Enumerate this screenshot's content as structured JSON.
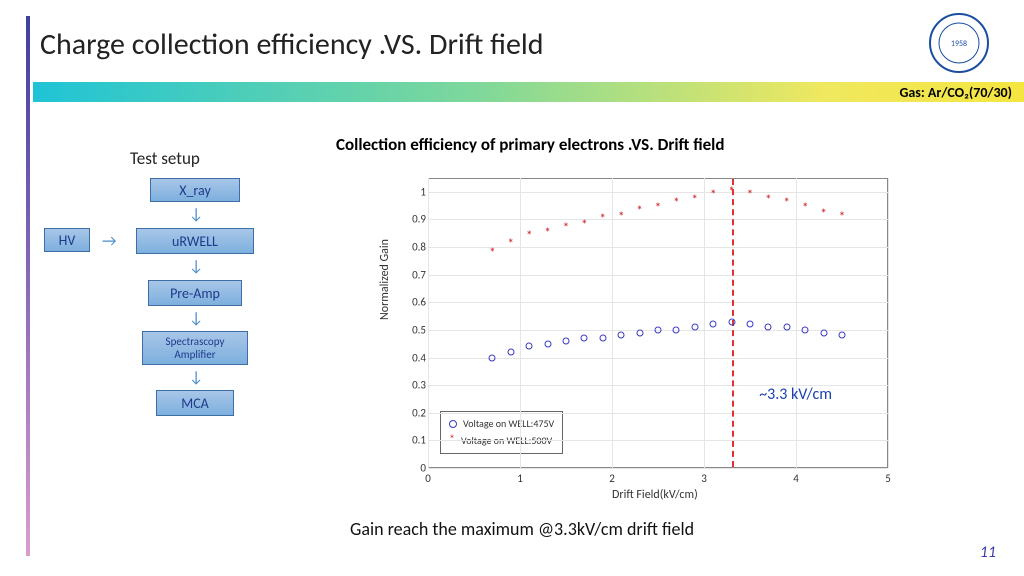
{
  "title": "Charge collection efficiency .VS. Drift field",
  "band_text": "Gas: Ar/CO₂(70/30)",
  "setup_title": "Test setup",
  "flow": {
    "xray": "X_ray",
    "hv": "HV",
    "urwell": "uRWELL",
    "preamp": "Pre-Amp",
    "spec": "Spectrascopy\nAmplifier",
    "mca": "MCA"
  },
  "chart_title": "Collection efficiency of primary electrons .VS. Drift field",
  "annotation": "~3.3 kV/cm",
  "caption": "Gain reach the maximum @3.3kV/cm drift field",
  "page": "11",
  "legend": {
    "s1": "Voltage on WELL:475V",
    "s2": "Voltage on WELL:500V"
  },
  "chart_data": {
    "type": "scatter",
    "title": "Collection efficiency of primary electrons .VS. Drift field",
    "xlabel": "Drift Field(kV/cm)",
    "ylabel": "Normalized Gain",
    "xlim": [
      0,
      5
    ],
    "ylim": [
      0,
      1.05
    ],
    "xticks": [
      0,
      1,
      2,
      3,
      4,
      5
    ],
    "yticks": [
      0,
      0.1,
      0.2,
      0.3,
      0.4,
      0.5,
      0.6,
      0.7,
      0.8,
      0.9,
      1
    ],
    "vline": 3.3,
    "annotation": {
      "text": "~3.3 kV/cm",
      "x": 3.6,
      "y": 0.3
    },
    "legend_position": "lower-left",
    "series": [
      {
        "name": "Voltage on WELL:475V",
        "marker": "circle",
        "color": "#3a3ac0",
        "x": [
          0.7,
          0.9,
          1.1,
          1.3,
          1.5,
          1.7,
          1.9,
          2.1,
          2.3,
          2.5,
          2.7,
          2.9,
          3.1,
          3.3,
          3.5,
          3.7,
          3.9,
          4.1,
          4.3,
          4.5
        ],
        "y": [
          0.4,
          0.42,
          0.44,
          0.45,
          0.46,
          0.47,
          0.47,
          0.48,
          0.49,
          0.5,
          0.5,
          0.51,
          0.52,
          0.53,
          0.52,
          0.51,
          0.51,
          0.5,
          0.49,
          0.48
        ]
      },
      {
        "name": "Voltage on WELL:500V",
        "marker": "star",
        "color": "#d43a3a",
        "x": [
          0.7,
          0.9,
          1.1,
          1.3,
          1.5,
          1.7,
          1.9,
          2.1,
          2.3,
          2.5,
          2.7,
          2.9,
          3.1,
          3.3,
          3.5,
          3.7,
          3.9,
          4.1,
          4.3,
          4.5
        ],
        "y": [
          0.78,
          0.81,
          0.84,
          0.85,
          0.87,
          0.88,
          0.9,
          0.91,
          0.93,
          0.94,
          0.96,
          0.97,
          0.99,
          1.0,
          0.99,
          0.97,
          0.96,
          0.94,
          0.92,
          0.91
        ]
      }
    ]
  }
}
